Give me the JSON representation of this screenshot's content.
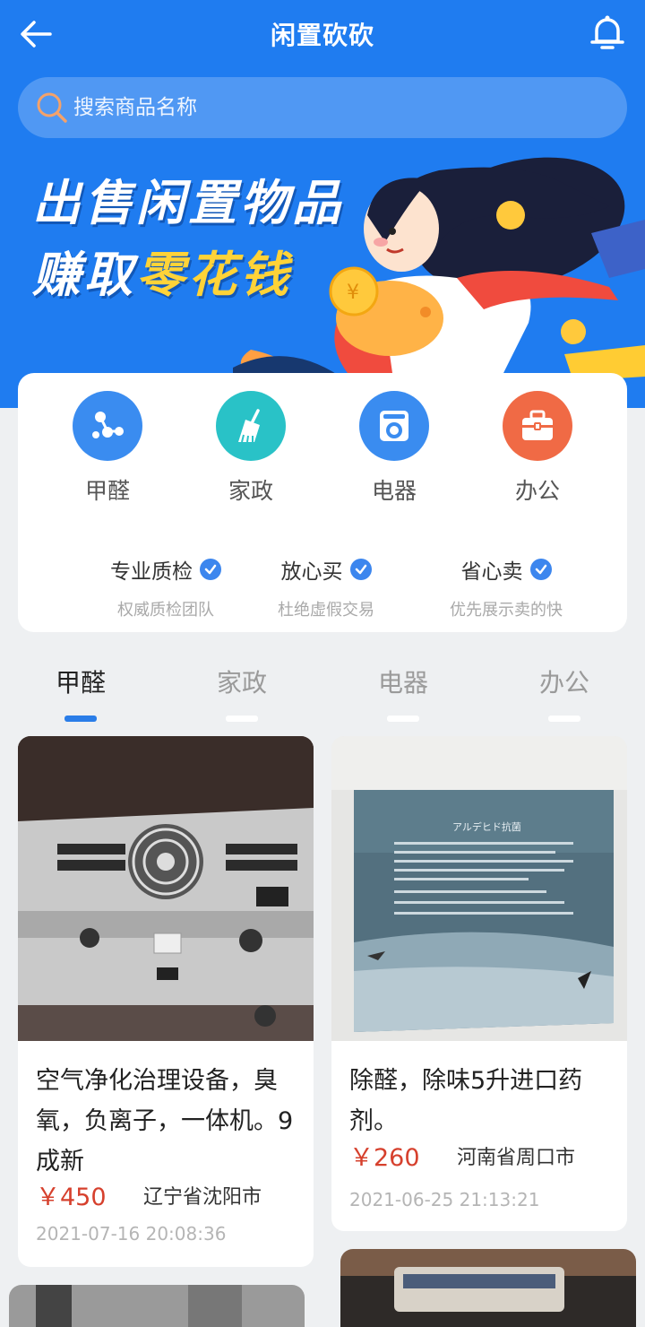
{
  "app_title": "闲置砍砍",
  "search": {
    "placeholder": "搜索商品名称"
  },
  "banner": {
    "line1": "出售闲置物品",
    "line2_prefix": "赚取",
    "line2_highlight": "零花钱"
  },
  "categories": [
    {
      "label": "甲醛",
      "icon": "molecule-icon",
      "color": "#3a8cf0"
    },
    {
      "label": "家政",
      "icon": "broom-icon",
      "color": "#29c2c7"
    },
    {
      "label": "电器",
      "icon": "washing-machine-icon",
      "color": "#3a8cf0"
    },
    {
      "label": "办公",
      "icon": "briefcase-icon",
      "color": "#f06a45"
    }
  ],
  "features": [
    {
      "title": "专业质检",
      "subtitle": "权威质检团队"
    },
    {
      "title": "放心买",
      "subtitle": "杜绝虚假交易"
    },
    {
      "title": "省心卖",
      "subtitle": "优先展示卖的快"
    }
  ],
  "tabs": [
    {
      "label": "甲醛",
      "active": true
    },
    {
      "label": "家政",
      "active": false
    },
    {
      "label": "电器",
      "active": false
    },
    {
      "label": "办公",
      "active": false
    }
  ],
  "products": [
    {
      "name": "空气净化治理设备，臭氧，负离子，一体机。9成新",
      "price": "￥450",
      "location": "辽宁省沈阳市",
      "date": "2021-07-16 20:08:36"
    },
    {
      "name": "除醛，除味5升进口药剂。",
      "price": "￥260",
      "location": "河南省周口市",
      "date": "2021-06-25 21:13:21"
    }
  ]
}
